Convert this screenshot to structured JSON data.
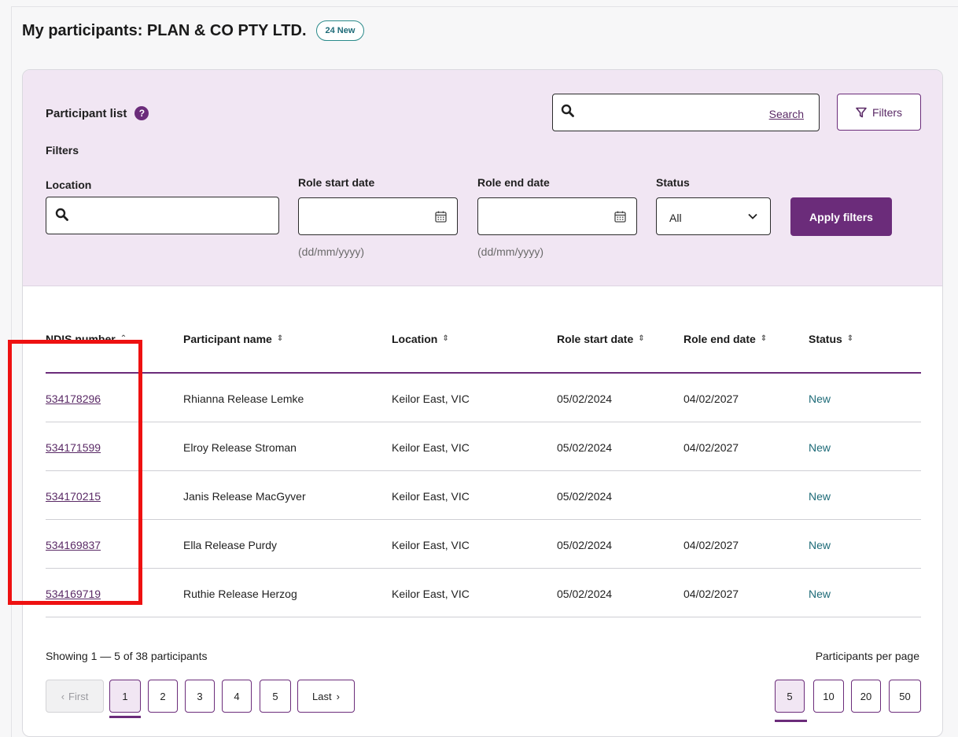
{
  "header": {
    "title": "My participants: PLAN & CO PTY LTD.",
    "new_badge": "24 New"
  },
  "filter_panel": {
    "title": "Participant list",
    "help_icon": "question-circle-icon",
    "filters_heading": "Filters",
    "search": {
      "value": "",
      "placeholder": "",
      "link_label": "Search",
      "icon": "search-icon"
    },
    "filters_button": {
      "label": "Filters",
      "icon": "funnel-icon"
    },
    "location": {
      "label": "Location",
      "value": "",
      "icon": "search-icon"
    },
    "role_start": {
      "label": "Role start date",
      "value": "",
      "hint": "(dd/mm/yyyy)",
      "icon": "calendar-icon"
    },
    "role_end": {
      "label": "Role end date",
      "value": "",
      "hint": "(dd/mm/yyyy)",
      "icon": "calendar-icon"
    },
    "status": {
      "label": "Status",
      "selected": "All",
      "icon": "chevron-down-icon"
    },
    "apply_label": "Apply filters"
  },
  "table": {
    "columns": [
      {
        "label": "NDIS number",
        "sort": "ascending"
      },
      {
        "label": "Participant name",
        "sort": "unsorted"
      },
      {
        "label": "Location",
        "sort": "unsorted"
      },
      {
        "label": "Role start date",
        "sort": "unsorted"
      },
      {
        "label": "Role end date",
        "sort": "unsorted"
      },
      {
        "label": "Status",
        "sort": "unsorted"
      }
    ],
    "rows": [
      {
        "ndis": "534178296",
        "name": "Rhianna Release Lemke",
        "location": "Keilor East, VIC",
        "start": "05/02/2024",
        "end": "04/02/2027",
        "status": "New"
      },
      {
        "ndis": "534171599",
        "name": "Elroy Release Stroman",
        "location": "Keilor East, VIC",
        "start": "05/02/2024",
        "end": "04/02/2027",
        "status": "New"
      },
      {
        "ndis": "534170215",
        "name": "Janis Release MacGyver",
        "location": "Keilor East, VIC",
        "start": "05/02/2024",
        "end": "",
        "status": "New"
      },
      {
        "ndis": "534169837",
        "name": "Ella Release Purdy",
        "location": "Keilor East, VIC",
        "start": "05/02/2024",
        "end": "04/02/2027",
        "status": "New"
      },
      {
        "ndis": "534169719",
        "name": "Ruthie Release Herzog",
        "location": "Keilor East, VIC",
        "start": "05/02/2024",
        "end": "04/02/2027",
        "status": "New"
      }
    ]
  },
  "footer": {
    "showing": "Showing 1 — 5 of 38 participants",
    "per_page_label": "Participants per page",
    "pagination": {
      "first": "First",
      "pages": [
        "1",
        "2",
        "3",
        "4",
        "5"
      ],
      "last": "Last",
      "current": "1"
    },
    "per_page_options": [
      "5",
      "10",
      "20",
      "50"
    ],
    "per_page_selected": "5"
  },
  "colors": {
    "brand_purple": "#6b2c7a",
    "panel_bg": "#f1e6f3",
    "status_teal": "#1e6b78",
    "annotation_red": "#ee1111"
  }
}
